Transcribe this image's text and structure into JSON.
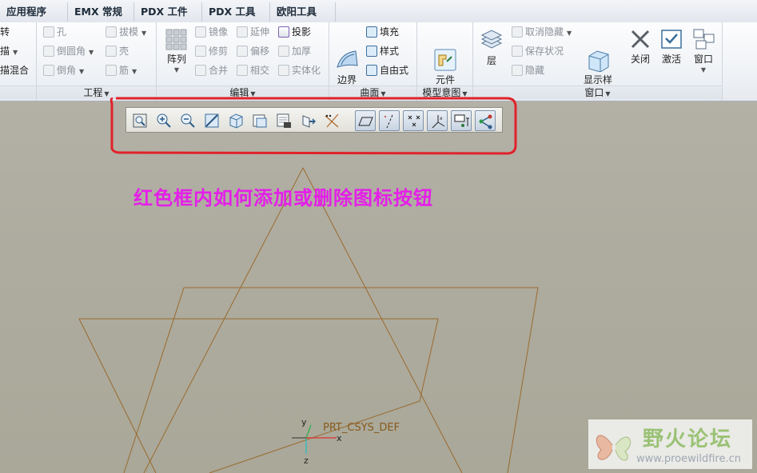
{
  "tabs": [
    "应用程序",
    "EMX 常规",
    "PDX 工件",
    "PDX 工具",
    "欧阳工具"
  ],
  "ribbon": {
    "left_partial": [
      "转",
      "描",
      "描混合"
    ],
    "engineering": {
      "label": "工程",
      "items": [
        "孔",
        "倒圆角",
        "倒角",
        "拔模",
        "壳",
        "筋"
      ]
    },
    "edit": {
      "label": "编辑",
      "array": "阵列",
      "items": [
        "镜像",
        "修剪",
        "合并",
        "延伸",
        "偏移",
        "相交",
        "投影",
        "加厚",
        "实体化"
      ]
    },
    "surface": {
      "label": "曲面",
      "boundary_blend": "边界\n混合",
      "items": [
        "填充",
        "样式",
        "自由式"
      ]
    },
    "model_intent": {
      "label": "模型意图",
      "component_interface": "元件\n界面"
    },
    "window": {
      "label": "窗口",
      "layer": "层",
      "items": [
        "取消隐藏",
        "保存状况",
        "隐藏"
      ],
      "display_style": "显示样\n式",
      "close": "关闭",
      "activate": "激活",
      "window": "窗口"
    }
  },
  "graphics_toolbar": {
    "buttons": [
      "refit-icon",
      "zoom-in-icon",
      "zoom-out-icon",
      "repaint-icon",
      "display-style-icon",
      "saved-orientations-icon",
      "view-manager-icon",
      "perspective-icon",
      "datum-display-icon",
      "plane-display-icon",
      "axis-display-icon",
      "point-display-icon",
      "csys-display-icon",
      "annotation-display-icon",
      "spin-center-icon"
    ],
    "active": [
      9,
      10,
      11,
      12,
      13,
      14
    ]
  },
  "annotation_text": "红色框内如何添加或删除图标按钮",
  "csys_label": "PRT_CSYS_DEF",
  "csys_axes": {
    "y": "y",
    "x": "x",
    "z": "z"
  },
  "watermark": {
    "title": "野火论坛",
    "url": "www.proewildfire.cn"
  },
  "colors": {
    "annotation": "#e51ee9",
    "highlight_box": "#e0222a",
    "wireframe": "#9b6a2e"
  }
}
